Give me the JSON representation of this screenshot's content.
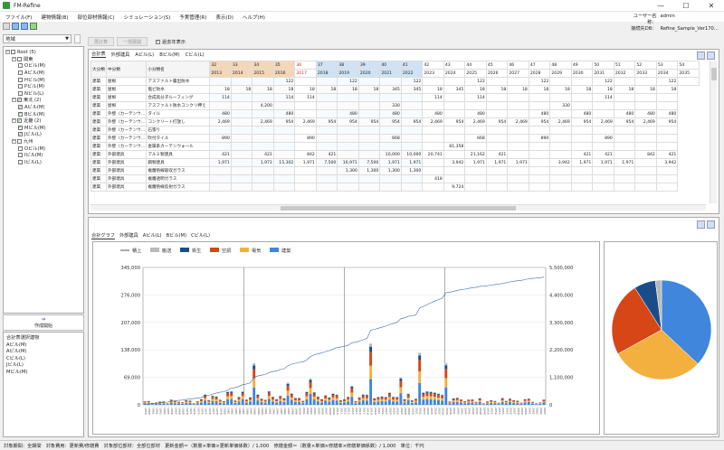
{
  "window": {
    "title": "FM-Refine",
    "minimize": "—",
    "maximize": "☐",
    "close": "✕"
  },
  "menu": [
    "ファイル(F)",
    "建物情報(B)",
    "部位部材情報(C)",
    "シミュレーション(S)",
    "予実管理(R)",
    "表示(D)",
    "ヘルプ(H)"
  ],
  "user": {
    "name_label": "ユーザー名称：",
    "name": "admin",
    "db_label": "接続先DB：",
    "db": "Refine_Sample_Ver170…"
  },
  "left": {
    "region": "地域",
    "tree": [
      {
        "t": "Root (5)",
        "lvl": 0,
        "ex": "−",
        "chk": false
      },
      {
        "t": "関東",
        "lvl": 1,
        "ex": "−",
        "chk": false
      },
      {
        "t": "Oビル(M)",
        "lvl": 2,
        "chk": false
      },
      {
        "t": "Aビル(M)",
        "lvl": 2,
        "chk": false
      },
      {
        "t": "Hビル(M)",
        "lvl": 2,
        "chk": false
      },
      {
        "t": "Pビル(M)",
        "lvl": 2,
        "chk": false
      },
      {
        "t": "Nビル(L)",
        "lvl": 2,
        "chk": false
      },
      {
        "t": "東北 (2)",
        "lvl": 1,
        "ex": "−",
        "chk": true
      },
      {
        "t": "Aビル(M)",
        "lvl": 2,
        "chk": true
      },
      {
        "t": "Bビル(M)",
        "lvl": 2,
        "chk": true
      },
      {
        "t": "近畿 (2)",
        "lvl": 1,
        "ex": "−",
        "chk": true
      },
      {
        "t": "Mビル(M)",
        "lvl": 2,
        "chk": true
      },
      {
        "t": "Jビル(L)",
        "lvl": 2,
        "chk": true
      },
      {
        "t": "九州",
        "lvl": 1,
        "ex": "−",
        "chk": false
      },
      {
        "t": "Oビル(M)",
        "lvl": 2,
        "chk": false
      },
      {
        "t": "Iビル(M)",
        "lvl": 2,
        "chk": false
      },
      {
        "t": "Iビル(L)",
        "lvl": 2,
        "chk": false
      }
    ],
    "create_button": "作成開始",
    "selection_title": "合計表選択建物",
    "selection": [
      "Aビル(M)",
      "Aビル(M)",
      "Cビル(L)",
      "Jビル(L)",
      "Mビル(M)"
    ]
  },
  "top_toolbar": {
    "btn1": "再計算",
    "btn2": "一括展開",
    "checkbox": "過去年表示"
  },
  "grid": {
    "tabs": [
      "合計表",
      "外部建具",
      "Aビル(L)",
      "Bビル(M)",
      "Cビル(L)"
    ],
    "head_cols": [
      "大分類",
      "中分類",
      "小分類名"
    ],
    "years": [
      {
        "n": "32",
        "y": "2013",
        "c": "#f5d7b5"
      },
      {
        "n": "33",
        "y": "2014",
        "c": "#f5d7b5"
      },
      {
        "n": "34",
        "y": "2015",
        "c": "#f5d7b5"
      },
      {
        "n": "35",
        "y": "2016",
        "c": "#f5d7b5"
      },
      {
        "n": "36",
        "y": "2017",
        "c": "#ffffff",
        "red": true
      },
      {
        "n": "37",
        "y": "2018",
        "c": "#cfe3f6"
      },
      {
        "n": "38",
        "y": "2019",
        "c": "#cfe3f6"
      },
      {
        "n": "39",
        "y": "2020",
        "c": "#cfe3f6"
      },
      {
        "n": "40",
        "y": "2021",
        "c": "#cfe3f6"
      },
      {
        "n": "41",
        "y": "2022",
        "c": "#cfe3f6"
      },
      {
        "n": "42",
        "y": "2023",
        "c": "#ffffff"
      },
      {
        "n": "43",
        "y": "2024",
        "c": "#ffffff"
      },
      {
        "n": "44",
        "y": "2025",
        "c": "#ffffff"
      },
      {
        "n": "45",
        "y": "2026",
        "c": "#ffffff"
      },
      {
        "n": "46",
        "y": "2027",
        "c": "#ffffff"
      },
      {
        "n": "47",
        "y": "2028",
        "c": "#ffffff"
      },
      {
        "n": "48",
        "y": "2029",
        "c": "#ffffff"
      },
      {
        "n": "49",
        "y": "2030",
        "c": "#ffffff"
      },
      {
        "n": "50",
        "y": "2031",
        "c": "#ffffff"
      },
      {
        "n": "51",
        "y": "2032",
        "c": "#ffffff"
      },
      {
        "n": "52",
        "y": "2033",
        "c": "#ffffff"
      },
      {
        "n": "53",
        "y": "2034",
        "c": "#ffffff"
      },
      {
        "n": "54",
        "y": "2035",
        "c": "#ffffff"
      }
    ],
    "rows": [
      [
        "建築",
        "屋根",
        "アスファルト露出防水",
        "",
        "",
        "",
        "122",
        "",
        "",
        "122",
        "",
        "",
        "122",
        "",
        "",
        "122",
        "",
        "",
        "122",
        "",
        "",
        "122",
        "",
        "",
        "122",
        ""
      ],
      [
        "建築",
        "屋根",
        "塩ビ防水",
        "18",
        "18",
        "18",
        "18",
        "18",
        "18",
        "18",
        "18",
        "345",
        "345",
        "18",
        "345",
        "18",
        "18",
        "18",
        "18",
        "18",
        "18",
        "18",
        "18",
        "18",
        "18"
      ],
      [
        "建築",
        "屋根",
        "合成高分子ルーフィング",
        "114",
        "",
        "",
        "114",
        "114",
        "",
        "",
        "",
        "",
        "",
        "114",
        "",
        "114",
        "",
        "",
        "",
        "",
        "",
        "114",
        "",
        "",
        ""
      ],
      [
        "建築",
        "屋根",
        "アスファルト防水コンクリ押え",
        "",
        "",
        "4,200",
        "",
        "",
        "",
        "",
        "",
        "330",
        "",
        "",
        "",
        "",
        "",
        "",
        "",
        "330",
        "",
        "",
        "",
        "",
        ""
      ],
      [
        "建築",
        "外壁（カーテンウ…",
        "タイル",
        "480",
        "",
        "",
        "480",
        "",
        "",
        "480",
        "",
        "480",
        "",
        "480",
        "",
        "480",
        "",
        "",
        "480",
        "",
        "480",
        "",
        "480",
        "480",
        "480"
      ],
      [
        "建築",
        "外壁（カーテンウ…",
        "コンクリート打放し",
        "2,469",
        "",
        "2,469",
        "954",
        "2,469",
        "954",
        "954",
        "954",
        "954",
        "954",
        "2,469",
        "954",
        "2,469",
        "954",
        "2,469",
        "954",
        "2,469",
        "954",
        "2,469",
        "954",
        "2,469",
        "954"
      ],
      [
        "建築",
        "外壁（カーテンウ…",
        "石張り",
        "",
        "",
        "",
        "",
        "",
        "",
        "",
        "",
        "",
        "",
        "",
        "",
        "",
        "",
        "",
        "",
        "",
        "",
        "",
        "",
        "",
        ""
      ],
      [
        "建築",
        "外壁（カーテンウ…",
        "吹付タイル",
        "890",
        "",
        "",
        "",
        "890",
        "",
        "",
        "",
        "668",
        "",
        "",
        "",
        "668",
        "",
        "",
        "890",
        "",
        "",
        "890",
        "",
        "",
        ""
      ],
      [
        "建築",
        "外壁（カーテンウ…",
        "金属系カーテンウォール",
        "",
        "",
        "",
        "",
        "",
        "",
        "",
        "",
        "",
        "",
        "",
        "81,358",
        "",
        "",
        "",
        "",
        "",
        "",
        "",
        "",
        "",
        ""
      ],
      [
        "建築",
        "外部建具",
        "アルミ製建具",
        "421",
        "",
        "421",
        "",
        "842",
        "421",
        "",
        "",
        "10,000",
        "10,000",
        "20,741",
        "",
        "21,162",
        "421",
        "",
        "",
        "",
        "421",
        "421",
        "",
        "842",
        "421"
      ],
      [
        "建築",
        "外部建具",
        "鋼製建具",
        "1,971",
        "",
        "1,971",
        "15,302",
        "1,971",
        "7,500",
        "16,971",
        "7,500",
        "1,971",
        "1,971",
        "",
        "3,942",
        "1,971",
        "1,971",
        "1,971",
        "",
        "3,942",
        "1,971",
        "1,971",
        "1,971",
        "",
        "3,942"
      ],
      [
        "建築",
        "外部建具",
        "複層熱線吸収ガラス",
        "",
        "",
        "",
        "",
        "",
        "",
        "1,300",
        "1,300",
        "1,300",
        "1,300",
        "",
        "",
        "",
        "",
        "",
        "",
        "",
        "",
        "",
        "",
        "",
        ""
      ],
      [
        "建築",
        "外部建具",
        "複層透明ガラス",
        "",
        "",
        "",
        "",
        "",
        "",
        "",
        "",
        "",
        "",
        "418",
        "",
        "",
        "",
        "",
        "",
        "",
        "",
        "",
        "",
        "",
        ""
      ],
      [
        "建築",
        "外部建具",
        "複層熱線反射ガラス",
        "",
        "",
        "",
        "",
        "",
        "",
        "",
        "",
        "",
        "",
        "",
        "9,724",
        "",
        "",
        "",
        "",
        "",
        "",
        "",
        "",
        "",
        ""
      ]
    ]
  },
  "chart": {
    "tabs": [
      "合計グラフ",
      "外部建具",
      "Aビル(L)",
      "Bビル(M)",
      "Cビル(L)"
    ],
    "chart_data": {
      "type": "bar",
      "stacked": true,
      "legend": [
        "積上",
        "搬送",
        "衛生",
        "空調",
        "電気",
        "建築"
      ],
      "colors": {
        "積上": "#555555",
        "搬送": "#b9b9b9",
        "衛生": "#1a4c8a",
        "空調": "#d64616",
        "電気": "#f3b03e",
        "建築": "#3f86dc"
      },
      "left_ticks": [
        "0",
        "69,000",
        "138,000",
        "207,000",
        "276,000",
        "345,000"
      ],
      "right_ticks": [
        "0",
        "1,100,000",
        "2,200,000",
        "3,300,000",
        "4,400,000",
        "5,500,000"
      ],
      "ylim": [
        0,
        345000
      ],
      "y2lim": [
        0,
        5500000
      ],
      "xstart": 1959,
      "xend": 2065
    },
    "pie": [
      {
        "name": "建築",
        "value": 37,
        "color": "#3f86dc"
      },
      {
        "name": "電気",
        "value": 30,
        "color": "#f3b03e"
      },
      {
        "name": "空調",
        "value": 24,
        "color": "#d64616"
      },
      {
        "name": "衛生",
        "value": 7,
        "color": "#1a4c8a"
      },
      {
        "name": "搬送",
        "value": 2,
        "color": "#b9b9b9"
      }
    ]
  },
  "status": "対象期間：全期間　対象費用：更新費/修繕費　対象部位部材：全部位部材　更新金額＝（数量×単価×更新単価係数）/ 1,000　修繕金額＝（数量×単価×修繕率×修繕単価係数）/ 1,000　単位：千円"
}
